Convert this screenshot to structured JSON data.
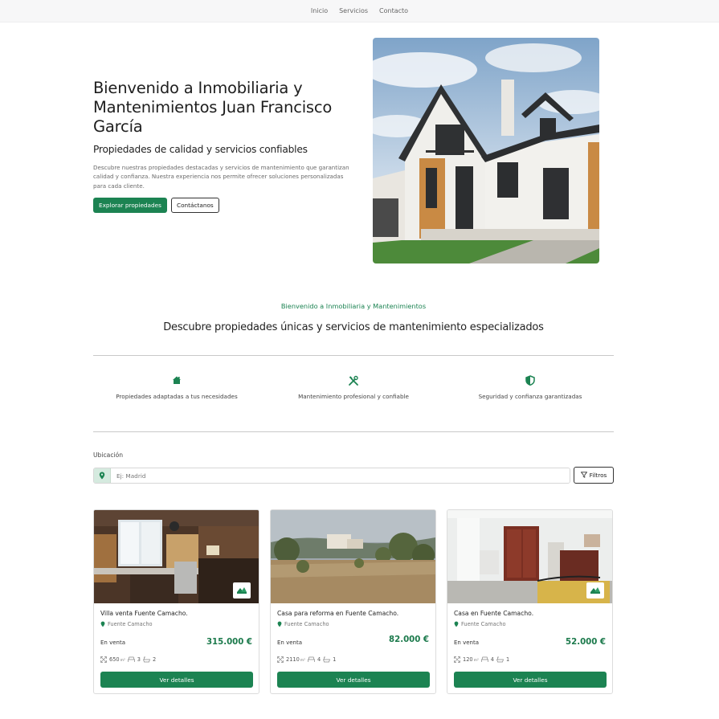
{
  "nav": {
    "items": [
      "Inicio",
      "Servicios",
      "Contacto"
    ]
  },
  "hero": {
    "title": "Bienvenido a Inmobiliaria y Mantenimientos Juan Francisco García",
    "subtitle": "Propiedades de calidad y servicios confiables",
    "description": "Descubre nuestras propiedades destacadas y servicios de mantenimiento que garantizan calidad y confianza. Nuestra experiencia nos permite ofrecer soluciones personalizadas para cada cliente.",
    "primary_button": "Explorar propiedades",
    "secondary_button": "Contáctanos"
  },
  "intro": {
    "kicker": "Bienvenido a Inmobiliaria y Mantenimientos",
    "title": "Descubre propiedades únicas y servicios de mantenimiento especializados"
  },
  "features": [
    {
      "icon": "home-icon",
      "text": "Propiedades adaptadas a tus necesidades"
    },
    {
      "icon": "tools-icon",
      "text": "Mantenimiento profesional y confiable"
    },
    {
      "icon": "shield-icon",
      "text": "Seguridad y confianza garantizadas"
    }
  ],
  "search": {
    "label": "Ubicación",
    "placeholder": "Ej: Madrid",
    "filter_label": "Filtros"
  },
  "properties": [
    {
      "title": "Villa venta Fuente Camacho.",
      "location": "Fuente Camacho",
      "status": "En venta",
      "price": "315.000 €",
      "area": "650",
      "area_unit": "m²",
      "bedrooms": "3",
      "bathrooms": "2",
      "button": "Ver detalles"
    },
    {
      "title": "Casa para reforma en Fuente Camacho.",
      "location": "Fuente Camacho",
      "status": "En venta",
      "price": "82.000 €",
      "area": "2110",
      "area_unit": "m²",
      "bedrooms": "4",
      "bathrooms": "1",
      "button": "Ver detalles"
    },
    {
      "title": "Casa en Fuente Camacho.",
      "location": "Fuente Camacho",
      "status": "En venta",
      "price": "52.000 €",
      "area": "120",
      "area_unit": "m²",
      "bedrooms": "4",
      "bathrooms": "1",
      "button": "Ver detalles"
    }
  ],
  "colors": {
    "brand_green": "#1c8352",
    "price_green": "#1c7a4c",
    "pin_bg": "#d5eadf"
  }
}
